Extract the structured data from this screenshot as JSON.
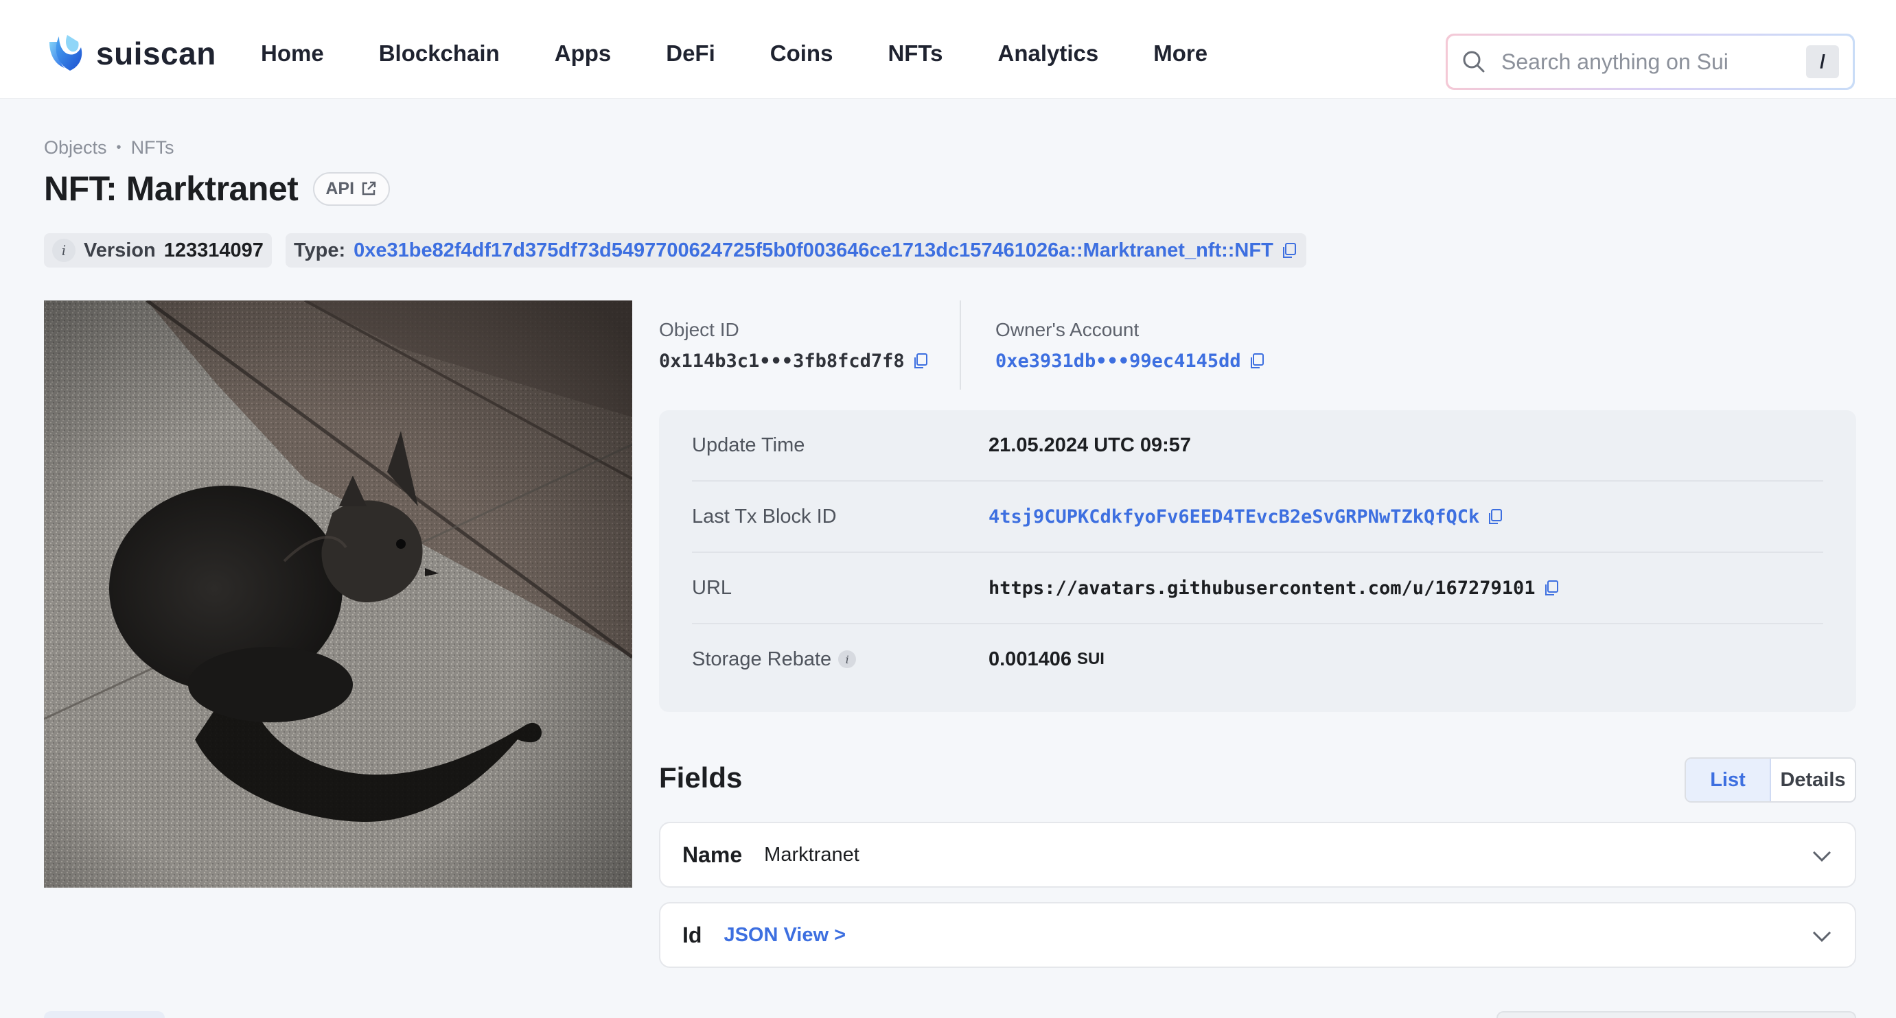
{
  "brand": {
    "name": "suiscan"
  },
  "nav": [
    {
      "label": "Home"
    },
    {
      "label": "Blockchain"
    },
    {
      "label": "Apps"
    },
    {
      "label": "DeFi"
    },
    {
      "label": "Coins"
    },
    {
      "label": "NFTs"
    },
    {
      "label": "Analytics"
    },
    {
      "label": "More"
    }
  ],
  "search": {
    "placeholder": "Search anything on Sui",
    "shortcut": "/"
  },
  "breadcrumb": [
    {
      "label": "Objects"
    },
    {
      "label": "NFTs"
    }
  ],
  "page": {
    "title": "NFT: Marktranet",
    "api_label": "API"
  },
  "meta": {
    "info_glyph": "i",
    "version_label": "Version",
    "version_value": "123314097",
    "type_label": "Type:",
    "type_value": "0xe31be82f4df17d375df73d5497700624725f5b0f003646ce1713dc157461026a::Marktranet_nft::NFT"
  },
  "ids": {
    "object_label": "Object ID",
    "object_value": "0x114b3c1•••3fb8fcd7f8",
    "owner_label": "Owner's Account",
    "owner_value": "0xe3931db•••99ec4145dd"
  },
  "properties": {
    "update_time_label": "Update Time",
    "update_time_value": "21.05.2024 UTC 09:57",
    "last_tx_label": "Last Tx Block ID",
    "last_tx_value": "4tsj9CUPKCdkfyoFv6EED4TEvcB2eSvGRPNwTZkQfQCk",
    "url_label": "URL",
    "url_value": "https://avatars.githubusercontent.com/u/167279101",
    "storage_label": "Storage Rebate",
    "storage_value": "0.001406",
    "storage_unit": "SUI"
  },
  "fields": {
    "title": "Fields",
    "view_list": "List",
    "view_details": "Details",
    "rows": [
      {
        "name": "Name",
        "value": "Marktranet"
      },
      {
        "name": "Id",
        "value": "JSON View >"
      }
    ]
  },
  "colors": {
    "accent": "#3d6fe0",
    "background": "#f5f7fa",
    "card": "#edf0f4"
  },
  "icons": {
    "logo": "suiscan-drop-logo",
    "search": "search-icon",
    "copy": "copy-icon",
    "external": "external-link-icon",
    "chevron": "chevron-down-icon"
  }
}
